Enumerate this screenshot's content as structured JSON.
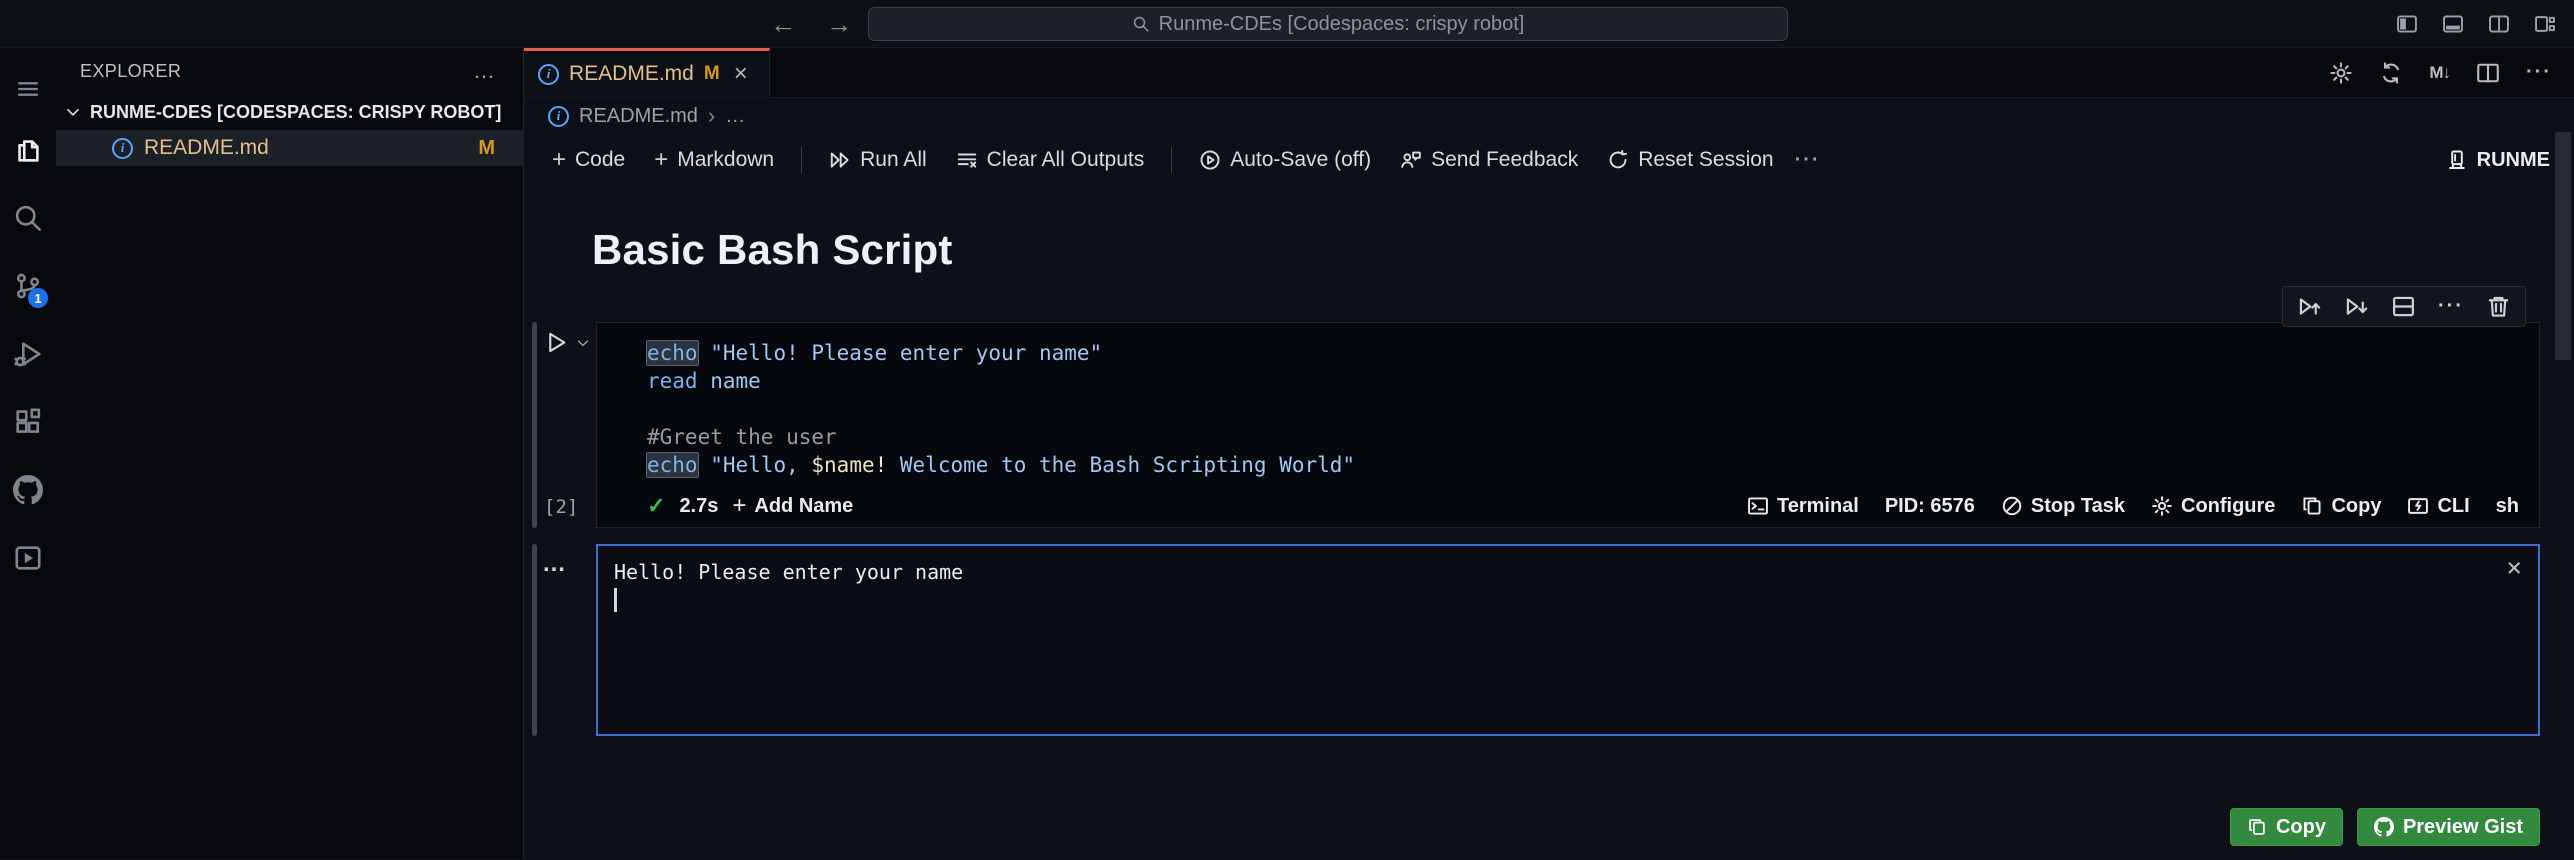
{
  "icons": {
    "back": "←",
    "forward": "→",
    "close": "×",
    "plus": "+",
    "ellipsis_h": "···",
    "ellipsis_dots": "…",
    "check": "✓",
    "markdown": "M↓",
    "info": "i",
    "chevron_right": "›"
  },
  "titlebar": {
    "search": "Runme-CDEs [Codespaces: crispy robot]"
  },
  "activity": {
    "scm_badge": "1"
  },
  "sidebar": {
    "header": "EXPLORER",
    "section": "RUNME-CDES [CODESPACES: CRISPY ROBOT]",
    "file_name": "README.md",
    "file_badge": "M"
  },
  "tabs": {
    "active_label": "README.md",
    "active_badge": "M"
  },
  "breadcrumb": {
    "file": "README.md"
  },
  "toolbar": {
    "code": "Code",
    "markdown": "Markdown",
    "run_all": "Run All",
    "clear_all_outputs": "Clear All Outputs",
    "auto_save": "Auto-Save (off)",
    "send_feedback": "Send Feedback",
    "reset_session": "Reset Session",
    "kernel": "RUNME"
  },
  "notebook": {
    "title": "Basic Bash Script",
    "exec_count": "[2]",
    "duration": "2.7s",
    "add_name": "Add Name",
    "status_right": {
      "terminal": "Terminal",
      "pid": "PID: 6576",
      "stop": "Stop Task",
      "configure": "Configure",
      "copy": "Copy",
      "cli": "CLI",
      "lang": "sh"
    },
    "code_lines": [
      [
        [
          "cmd hl",
          "echo"
        ],
        [
          "plain",
          " "
        ],
        [
          "str",
          "\"Hello! Please enter your name\""
        ]
      ],
      [
        [
          "cmd",
          "read"
        ],
        [
          "plain",
          " "
        ],
        [
          "str",
          "name"
        ]
      ],
      [],
      [
        [
          "comment",
          "#Greet the user"
        ]
      ],
      [
        [
          "cmd hl",
          "echo"
        ],
        [
          "plain",
          " "
        ],
        [
          "str",
          "\"Hello, "
        ],
        [
          "var",
          "$name"
        ],
        [
          "plain",
          "!"
        ],
        [
          "str",
          " Welcome to the Bash Scripting World\""
        ]
      ]
    ],
    "output": {
      "line1": "Hello! Please enter your name"
    },
    "actions": {
      "copy": "Copy",
      "preview_gist": "Preview Gist"
    }
  },
  "colors": {
    "accent_orange": "#e5604a",
    "modified_yellow": "#e2c08d",
    "badge_gold": "#d29922",
    "badge_blue": "#1f6feb",
    "output_border_blue": "#3a6fd4",
    "button_green": "#338a3e",
    "check_green": "#3fb950",
    "info_blue": "#58a6ff"
  }
}
